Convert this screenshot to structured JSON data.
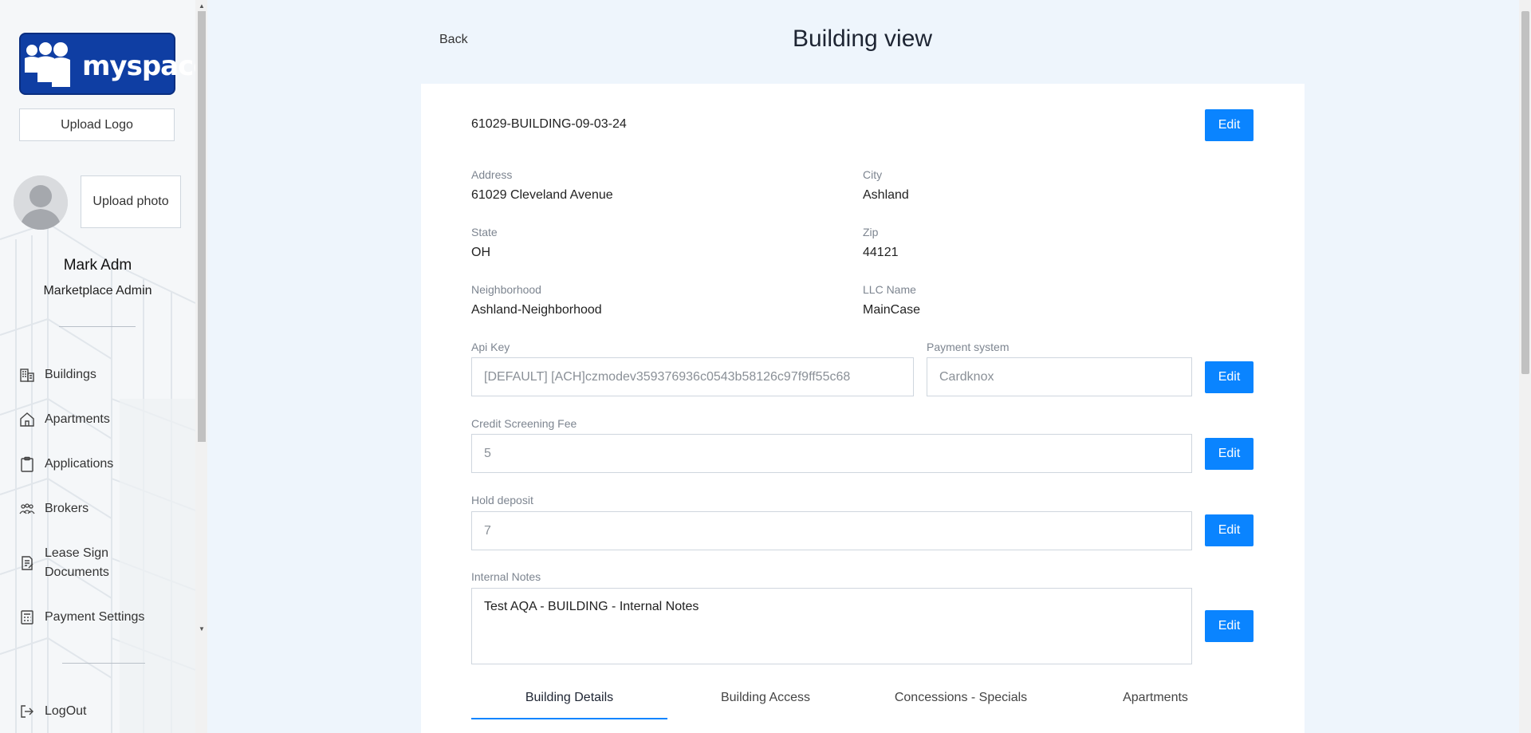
{
  "sidebar": {
    "logo_text": "myspace",
    "upload_logo_label": "Upload Logo",
    "upload_photo_label": "Upload photo",
    "user_name": "Mark Adm",
    "user_role": "Marketplace Admin",
    "nav": [
      {
        "label": "Buildings",
        "icon": "building-icon"
      },
      {
        "label": "Apartments",
        "icon": "home-icon"
      },
      {
        "label": "Applications",
        "icon": "clipboard-icon"
      },
      {
        "label": "Brokers",
        "icon": "people-icon"
      },
      {
        "label": "Lease Sign Documents",
        "icon": "document-sign-icon"
      },
      {
        "label": "Payment Settings",
        "icon": "calculator-icon"
      }
    ],
    "logout_label": "LogOut"
  },
  "header": {
    "back_label": "Back",
    "title": "Building view"
  },
  "building": {
    "id": "61029-BUILDING-09-03-24",
    "edit_label": "Edit",
    "address_label": "Address",
    "address": "61029 Cleveland Avenue",
    "city_label": "City",
    "city": "Ashland",
    "state_label": "State",
    "state": "OH",
    "zip_label": "Zip",
    "zip": "44121",
    "neighborhood_label": "Neighborhood",
    "neighborhood": "Ashland-Neighborhood",
    "llc_label": "LLC Name",
    "llc": "MainCase",
    "api_key_label": "Api Key",
    "api_key": "[DEFAULT] [ACH]czmodev359376936c0543b58126c97f9ff55c68",
    "payment_system_label": "Payment system",
    "payment_system": "Cardknox",
    "credit_fee_label": "Credit Screening Fee",
    "credit_fee": "5",
    "hold_deposit_label": "Hold deposit",
    "hold_deposit": "7",
    "notes_label": "Internal Notes",
    "notes": "Test AQA - BUILDING - Internal Notes"
  },
  "tabs": [
    {
      "label": "Building Details",
      "active": true
    },
    {
      "label": "Building Access",
      "active": false
    },
    {
      "label": "Concessions - Specials",
      "active": false
    },
    {
      "label": "Apartments",
      "active": false
    }
  ],
  "colors": {
    "accent": "#0a84ff",
    "logo_bg": "#0f3ea3",
    "page_bg": "#eef5fc"
  }
}
